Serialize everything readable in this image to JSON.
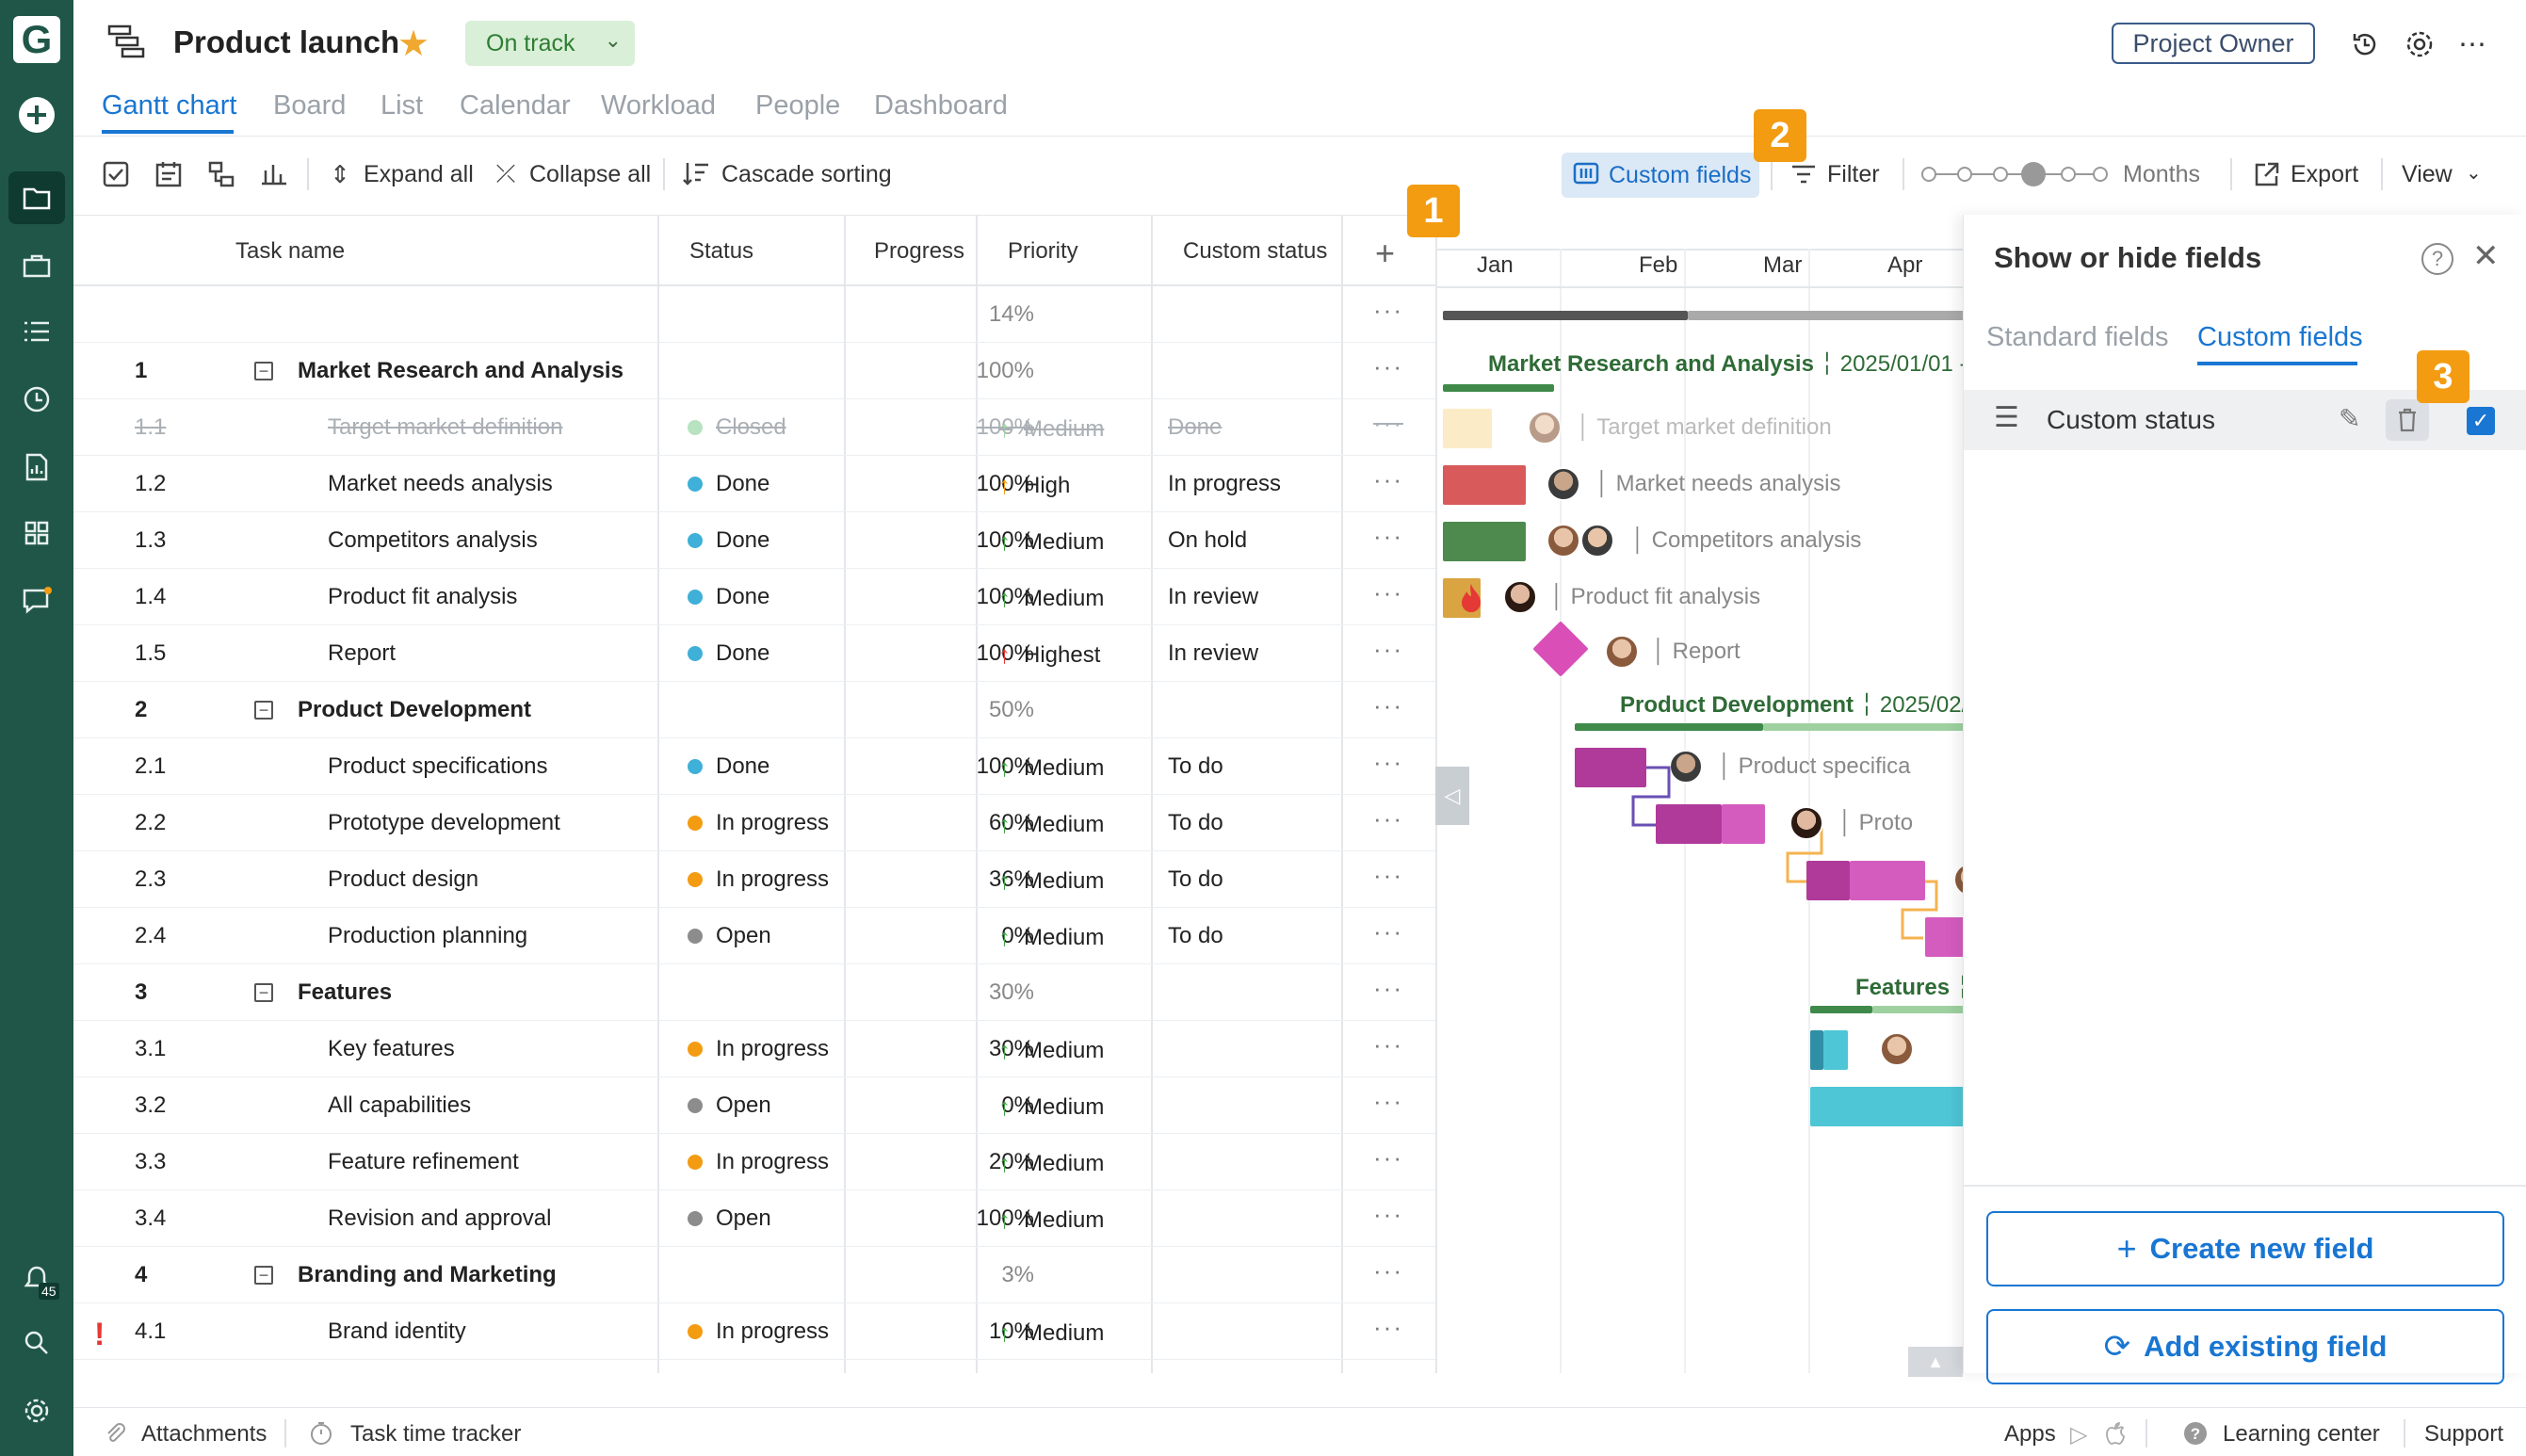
{
  "app": {
    "project_title": "Product launch",
    "status": "On track",
    "owner_button": "Project Owner"
  },
  "tabs": [
    "Gantt chart",
    "Board",
    "List",
    "Calendar",
    "Workload",
    "People",
    "Dashboard"
  ],
  "toolbar": {
    "expand_all": "Expand all",
    "collapse_all": "Collapse all",
    "cascade_sorting": "Cascade sorting",
    "custom_fields": "Custom fields",
    "filter": "Filter",
    "zoom_label": "Months",
    "export": "Export",
    "view": "View"
  },
  "grid": {
    "columns": [
      "Task name",
      "Status",
      "Progress",
      "Priority",
      "Custom status"
    ],
    "summary_progress": "14%",
    "rows": [
      {
        "num": "1",
        "name": "Market Research and Analysis",
        "group": true,
        "progress": "100%"
      },
      {
        "num": "1.1",
        "name": "Target market definition",
        "status": "Closed",
        "status_color": "#b7e3c0",
        "progress": "100%",
        "priority": "Medium",
        "priority_color": "#a5d6a7",
        "arrow": "↑",
        "custom": "Done",
        "closed": true
      },
      {
        "num": "1.2",
        "name": "Market needs analysis",
        "status": "Done",
        "status_color": "#3fb0d8",
        "progress": "100%",
        "priority": "High",
        "priority_color": "#f39c12",
        "arrow": "↑",
        "custom": "In progress"
      },
      {
        "num": "1.3",
        "name": "Competitors analysis",
        "status": "Done",
        "status_color": "#3fb0d8",
        "progress": "100%",
        "priority": "Medium",
        "priority_color": "#43a047",
        "arrow": "↑",
        "custom": "On hold"
      },
      {
        "num": "1.4",
        "name": "Product fit analysis",
        "status": "Done",
        "status_color": "#3fb0d8",
        "progress": "100%",
        "priority": "Medium",
        "priority_color": "#43a047",
        "arrow": "↑",
        "custom": "In review"
      },
      {
        "num": "1.5",
        "name": "Report",
        "status": "Done",
        "status_color": "#3fb0d8",
        "progress": "100%",
        "priority": "Highest",
        "priority_color": "#e53935",
        "arrow": "↑",
        "custom": "In review"
      },
      {
        "num": "2",
        "name": "Product Development",
        "group": true,
        "progress": "50%"
      },
      {
        "num": "2.1",
        "name": "Product specifications",
        "status": "Done",
        "status_color": "#3fb0d8",
        "progress": "100%",
        "priority": "Medium",
        "priority_color": "#43a047",
        "arrow": "↑",
        "custom": "To do"
      },
      {
        "num": "2.2",
        "name": "Prototype development",
        "status": "In progress",
        "status_color": "#f39c12",
        "progress": "60%",
        "priority": "Medium",
        "priority_color": "#43a047",
        "arrow": "↑",
        "custom": "To do"
      },
      {
        "num": "2.3",
        "name": "Product design",
        "status": "In progress",
        "status_color": "#f39c12",
        "progress": "36%",
        "priority": "Medium",
        "priority_color": "#43a047",
        "arrow": "↑",
        "custom": "To do"
      },
      {
        "num": "2.4",
        "name": "Production planning",
        "status": "Open",
        "status_color": "#8c8c8c",
        "progress": "0%",
        "priority": "Medium",
        "priority_color": "#43a047",
        "arrow": "↑",
        "custom": "To do"
      },
      {
        "num": "3",
        "name": "Features",
        "group": true,
        "progress": "30%"
      },
      {
        "num": "3.1",
        "name": "Key features",
        "status": "In progress",
        "status_color": "#f39c12",
        "progress": "30%",
        "priority": "Medium",
        "priority_color": "#43a047",
        "arrow": "↑",
        "custom": ""
      },
      {
        "num": "3.2",
        "name": "All capabilities",
        "status": "Open",
        "status_color": "#8c8c8c",
        "progress": "0%",
        "priority": "Medium",
        "priority_color": "#43a047",
        "arrow": "↑",
        "custom": ""
      },
      {
        "num": "3.3",
        "name": "Feature refinement",
        "status": "In progress",
        "status_color": "#f39c12",
        "progress": "20%",
        "priority": "Medium",
        "priority_color": "#43a047",
        "arrow": "↑",
        "custom": ""
      },
      {
        "num": "3.4",
        "name": "Revision and approval",
        "status": "Open",
        "status_color": "#8c8c8c",
        "progress": "100%",
        "priority": "Medium",
        "priority_color": "#43a047",
        "arrow": "↑",
        "custom": ""
      },
      {
        "num": "4",
        "name": "Branding and Marketing",
        "group": true,
        "progress": "3%"
      },
      {
        "num": "4.1",
        "name": "Brand identity",
        "status": "In progress",
        "status_color": "#f39c12",
        "progress": "10%",
        "priority": "Medium",
        "priority_color": "#43a047",
        "arrow": "↑",
        "custom": ""
      }
    ]
  },
  "gantt": {
    "months": [
      "Jan",
      "Feb",
      "Mar",
      "Apr"
    ],
    "group1_title": "Market Research and Analysis",
    "group1_dates": "2025/01/01 -",
    "group2_title": "Product Development",
    "group2_dates": "2025/02/0",
    "group3_title": "Features",
    "labels": {
      "t11": "Target market definition",
      "t12": "Market needs analysis",
      "t13": "Competitors analysis",
      "t14": "Product fit analysis",
      "t15": "Report",
      "t21": "Product specifica",
      "t22": "Proto"
    }
  },
  "panel": {
    "title": "Show or hide fields",
    "tab_standard": "Standard fields",
    "tab_custom": "Custom fields",
    "field_name": "Custom status",
    "create_button": "Create new field",
    "add_button": "Add existing field"
  },
  "callouts": [
    "1",
    "2",
    "3"
  ],
  "notifications_count": "45",
  "footer": {
    "attachments": "Attachments",
    "time_tracker": "Task time tracker",
    "apps": "Apps",
    "learning": "Learning center",
    "support": "Support"
  }
}
